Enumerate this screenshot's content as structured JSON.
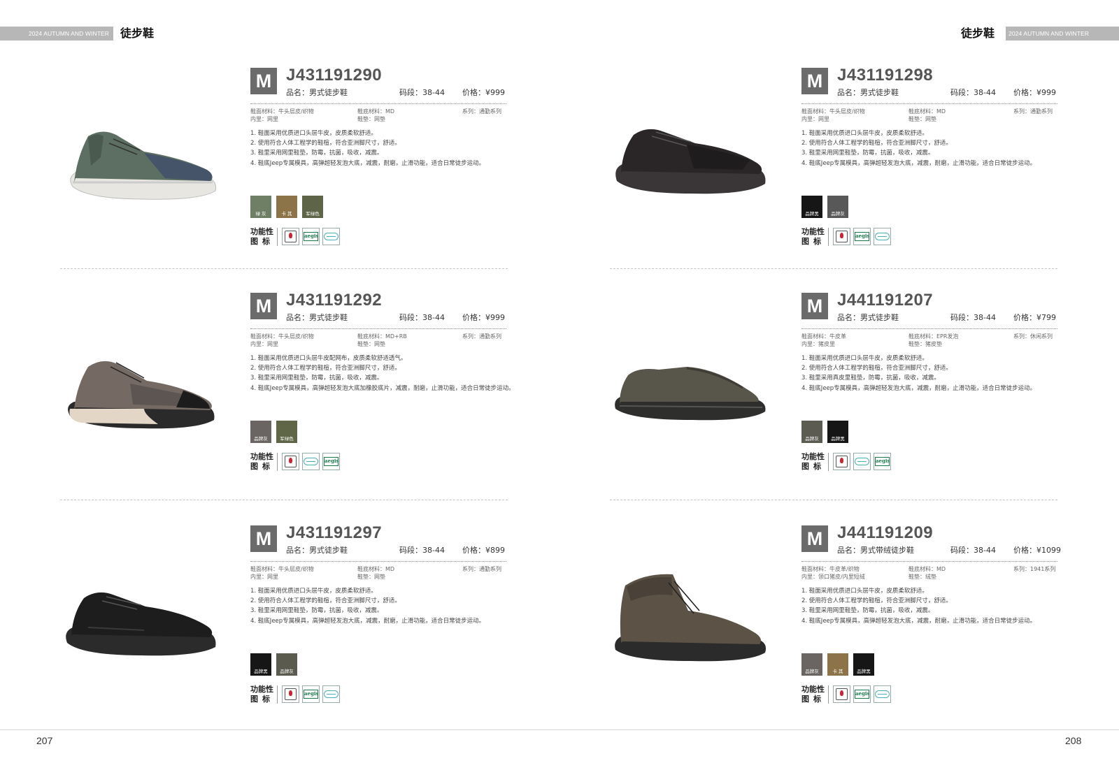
{
  "header": {
    "season": "2024 AUTUMN AND WINTER",
    "category": "徒步鞋"
  },
  "pages": {
    "left_number": "207",
    "right_number": "208"
  },
  "labels": {
    "gender_badge": "M",
    "function_line1": "功能性",
    "function_line2": "图标"
  },
  "icons": [
    "fire-retardant-icon",
    "aegis-antibacterial-icon",
    "breathable-wave-icon"
  ],
  "products": [
    {
      "code": "J431191290",
      "name": "品名：男式徒步鞋",
      "size": "码段：38-44",
      "price": "价格：¥999",
      "upper": "鞋面材料：牛头层皮/织物",
      "lining": "内里：网里",
      "sole": "鞋底材料：MD",
      "insole": "鞋垫：网垫",
      "series": "系列：通勤系列",
      "features": [
        "1. 鞋面采用优质进口头层牛皮，皮质柔软舒适。",
        "2. 使用符合人体工程学的鞋楦，符合亚洲脚尺寸，舒适。",
        "3. 鞋里采用网里鞋垫，防霉，抗菌，吸收，减震。",
        "4. 鞋底Jeep专属模具，高弹超轻发泡大底，减震，耐磨，止滑功能，适合日常徒步运动。"
      ],
      "colors": [
        {
          "label": "绿 灰",
          "hex": "#6f7f66"
        },
        {
          "label": "卡 其",
          "hex": "#8c7448"
        },
        {
          "label": "军绿色",
          "hex": "#5d6447"
        }
      ],
      "icon_order": [
        0,
        1,
        2
      ]
    },
    {
      "code": "J431191292",
      "name": "品名：男式徒步鞋",
      "size": "码段：38-44",
      "price": "价格：¥999",
      "upper": "鞋面材料：牛头层皮/织物",
      "lining": "内里：网里",
      "sole": "鞋底材料：MD+RB",
      "insole": "鞋垫：网垫",
      "series": "系列：通勤系列",
      "features": [
        "1. 鞋面采用优质进口头层牛皮配网布，皮质柔软舒适透气。",
        "2. 使用符合人体工程学的鞋楦，符合亚洲脚尺寸，舒适。",
        "3. 鞋里采用网里鞋垫，防霉，抗菌，吸收，减震。",
        "4. 鞋底Jeep专属模具，高弹超轻发泡大底加橡胶底片，减震，耐磨，止滑功能，适合日常徒步运动。"
      ],
      "colors": [
        {
          "label": "品牌灰",
          "hex": "#6a6562"
        },
        {
          "label": "军绿色",
          "hex": "#5e6647"
        }
      ],
      "icon_order": [
        0,
        2,
        1
      ]
    },
    {
      "code": "J431191297",
      "name": "品名：男式徒步鞋",
      "size": "码段：38-44",
      "price": "价格：¥899",
      "upper": "鞋面材料：牛头层皮/织物",
      "lining": "内里：网里",
      "sole": "鞋底材料：MD",
      "insole": "鞋垫：网垫",
      "series": "系列：通勤系列",
      "features": [
        "1. 鞋面采用优质进口头层牛皮，皮质柔软舒适。",
        "2. 使用符合人体工程学的鞋楦，符合亚洲脚尺寸，舒适。",
        "3. 鞋里采用网里鞋垫，防霉，抗菌，吸收，减震。",
        "4. 鞋底Jeep专属模具，高弹超轻发泡大底，减震，耐磨，止滑功能，适合日常徒步运动。"
      ],
      "colors": [
        {
          "label": "品牌黑",
          "hex": "#161616"
        },
        {
          "label": "品牌灰",
          "hex": "#5b5a4e"
        }
      ],
      "icon_order": [
        0,
        1,
        2
      ]
    },
    {
      "code": "J431191298",
      "name": "品名：男式徒步鞋",
      "size": "码段：38-44",
      "price": "价格：¥999",
      "upper": "鞋面材料：牛头层皮/织物",
      "lining": "内里：网里",
      "sole": "鞋底材料：MD",
      "insole": "鞋垫：网垫",
      "series": "系列：通勤系列",
      "features": [
        "1. 鞋面采用优质进口头层牛皮，皮质柔软舒适。",
        "2. 使用符合人体工程学的鞋楦，符合亚洲脚尺寸，舒适。",
        "3. 鞋里采用网里鞋垫，防霉，抗菌，吸收，减震。",
        "4. 鞋底Jeep专属模具，高弹超轻发泡大底，减震，耐磨，止滑功能，适合日常徒步运动。"
      ],
      "colors": [
        {
          "label": "品牌黑",
          "hex": "#161616"
        },
        {
          "label": "品牌灰",
          "hex": "#585858"
        }
      ],
      "icon_order": [
        0,
        1,
        2
      ]
    },
    {
      "code": "J441191207",
      "name": "品名：男式徒步鞋",
      "size": "码段：38-44",
      "price": "价格：¥799",
      "upper": "鞋面材料：牛皮革",
      "lining": "内里：猪皮里",
      "sole": "鞋底材料：EPR发泡",
      "insole": "鞋垫：猪皮垫",
      "series": "系列：休闲系列",
      "features": [
        "1. 鞋面采用优质进口头层牛皮，皮质柔软舒适。",
        "2. 使用符合人体工程学的鞋楦，符合亚洲脚尺寸，舒适。",
        "3. 鞋里采用真皮里鞋垫，防霉，抗菌，吸收，减震。",
        "4. 鞋底Jeep专属模具，高弹超轻发泡大底，减震，耐磨，止滑功能，适合日常徒步运动。"
      ],
      "colors": [
        {
          "label": "品牌灰",
          "hex": "#5b5b52"
        },
        {
          "label": "品牌黑",
          "hex": "#161616"
        }
      ],
      "icon_order": [
        0,
        2,
        1
      ]
    },
    {
      "code": "J441191209",
      "name": "品名：男式带绒徒步鞋",
      "size": "码段：38-44",
      "price": "价格：¥1099",
      "upper": "鞋面材料：牛皮革/织物",
      "lining": "内里：领口猪皮/内里短绒",
      "sole": "鞋底材料：MD",
      "insole": "鞋垫：绒垫",
      "series": "系列：1941系列",
      "features": [
        "1. 鞋面采用优质进口头层牛皮，皮质柔软舒适。",
        "2. 使用符合人体工程学的鞋楦，符合亚洲脚尺寸，舒适。",
        "3. 鞋里采用网里鞋垫，防霉，抗菌，吸收，减震。",
        "4. 鞋底Jeep专属模具，高弹超轻发泡大底，减震，耐磨，止滑功能，适合日常徒步运动。"
      ],
      "colors": [
        {
          "label": "品牌灰",
          "hex": "#6a6562"
        },
        {
          "label": "卡 其",
          "hex": "#8c7448"
        },
        {
          "label": "品牌黑",
          "hex": "#161616"
        }
      ],
      "icon_order": [
        0,
        1,
        2
      ]
    }
  ]
}
